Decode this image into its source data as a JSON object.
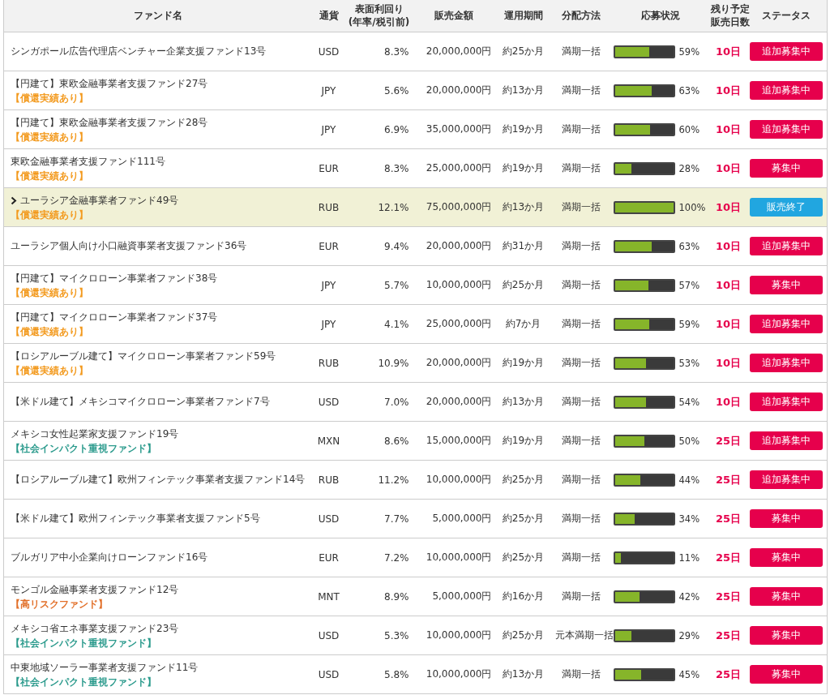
{
  "columns": [
    [
      "ファンド名"
    ],
    [
      "通貨"
    ],
    [
      "表面利回り",
      "(年率/税引前)"
    ],
    [
      "販売金額"
    ],
    [
      "運用期間"
    ],
    [
      "分配方法"
    ],
    [
      "応募状況"
    ],
    [
      "残り予定",
      "販売日数"
    ],
    [
      "ステータス"
    ]
  ],
  "rows": [
    {
      "name": "シンガポール広告代理店ベンチャー企業支援ファンド13号",
      "currency": "USD",
      "rate": "8.3%",
      "amount": "20,000,000円",
      "period": "約25か月",
      "distribution": "満期一括",
      "level": 0.59,
      "percent": "59%",
      "days": "10日",
      "status": {
        "label": "追加募集中",
        "kind": "open"
      },
      "selected": false
    },
    {
      "name": "【円建て】東欧金融事業者支援ファンド27号",
      "tag": {
        "text": "【償還実績あり】",
        "kind": "repaid"
      },
      "currency": "JPY",
      "rate": "5.6%",
      "amount": "20,000,000円",
      "period": "約13か月",
      "distribution": "満期一括",
      "level": 0.63,
      "percent": "63%",
      "days": "10日",
      "status": {
        "label": "追加募集中",
        "kind": "open"
      },
      "selected": false
    },
    {
      "name": "【円建て】東欧金融事業者支援ファンド28号",
      "tag": {
        "text": "【償還実績あり】",
        "kind": "repaid"
      },
      "currency": "JPY",
      "rate": "6.9%",
      "amount": "35,000,000円",
      "period": "約19か月",
      "distribution": "満期一括",
      "level": 0.6,
      "percent": "60%",
      "days": "10日",
      "status": {
        "label": "追加募集中",
        "kind": "open"
      },
      "selected": false
    },
    {
      "name": "東欧金融事業者支援ファンド111号",
      "tag": {
        "text": "【償還実績あり】",
        "kind": "repaid"
      },
      "currency": "EUR",
      "rate": "8.3%",
      "amount": "25,000,000円",
      "period": "約19か月",
      "distribution": "満期一括",
      "level": 0.28,
      "percent": "28%",
      "days": "10日",
      "status": {
        "label": "募集中",
        "kind": "open"
      },
      "selected": false
    },
    {
      "name": "ユーラシア金融事業者ファンド49号",
      "tag": {
        "text": "【償還実績あり】",
        "kind": "repaid"
      },
      "currency": "RUB",
      "rate": "12.1%",
      "amount": "75,000,000円",
      "period": "約13か月",
      "distribution": "満期一括",
      "level": 1,
      "percent": "100%",
      "days": "10日",
      "status": {
        "label": "販売終了",
        "kind": "closed"
      },
      "selected": true
    },
    {
      "name": "ユーラシア個人向け小口融資事業者支援ファンド36号",
      "currency": "EUR",
      "rate": "9.4%",
      "amount": "20,000,000円",
      "period": "約31か月",
      "distribution": "満期一括",
      "level": 0.63,
      "percent": "63%",
      "days": "10日",
      "status": {
        "label": "追加募集中",
        "kind": "open"
      },
      "selected": false
    },
    {
      "name": "【円建て】マイクロローン事業者ファンド38号",
      "tag": {
        "text": "【償還実績あり】",
        "kind": "repaid"
      },
      "currency": "JPY",
      "rate": "5.7%",
      "amount": "10,000,000円",
      "period": "約25か月",
      "distribution": "満期一括",
      "level": 0.57,
      "percent": "57%",
      "days": "10日",
      "status": {
        "label": "募集中",
        "kind": "open"
      },
      "selected": false
    },
    {
      "name": "【円建て】マイクロローン事業者ファンド37号",
      "tag": {
        "text": "【償還実績あり】",
        "kind": "repaid"
      },
      "currency": "JPY",
      "rate": "4.1%",
      "amount": "25,000,000円",
      "period": "約7か月",
      "distribution": "満期一括",
      "level": 0.59,
      "percent": "59%",
      "days": "10日",
      "status": {
        "label": "追加募集中",
        "kind": "open"
      },
      "selected": false
    },
    {
      "name": "【ロシアルーブル建て】マイクロローン事業者ファンド59号",
      "tag": {
        "text": "【償還実績あり】",
        "kind": "repaid"
      },
      "currency": "RUB",
      "rate": "10.9%",
      "amount": "20,000,000円",
      "period": "約19か月",
      "distribution": "満期一括",
      "level": 0.53,
      "percent": "53%",
      "days": "10日",
      "status": {
        "label": "追加募集中",
        "kind": "open"
      },
      "selected": false
    },
    {
      "name": "【米ドル建て】メキシコマイクロローン事業者ファンド7号",
      "currency": "USD",
      "rate": "7.0%",
      "amount": "20,000,000円",
      "period": "約13か月",
      "distribution": "満期一括",
      "level": 0.54,
      "percent": "54%",
      "days": "10日",
      "status": {
        "label": "追加募集中",
        "kind": "open"
      },
      "selected": false
    },
    {
      "name": "メキシコ女性起業家支援ファンド19号",
      "tag": {
        "text": "【社会インパクト重視ファンド】",
        "kind": "impact"
      },
      "currency": "MXN",
      "rate": "8.6%",
      "amount": "15,000,000円",
      "period": "約19か月",
      "distribution": "満期一括",
      "level": 0.5,
      "percent": "50%",
      "days": "25日",
      "status": {
        "label": "追加募集中",
        "kind": "open"
      },
      "selected": false
    },
    {
      "name": "【ロシアルーブル建て】欧州フィンテック事業者支援ファンド14号",
      "currency": "RUB",
      "rate": "11.2%",
      "amount": "10,000,000円",
      "period": "約25か月",
      "distribution": "満期一括",
      "level": 0.44,
      "percent": "44%",
      "days": "25日",
      "status": {
        "label": "追加募集中",
        "kind": "open"
      },
      "selected": false
    },
    {
      "name": "【米ドル建て】欧州フィンテック事業者支援ファンド5号",
      "currency": "USD",
      "rate": "7.7%",
      "amount": "5,000,000円",
      "period": "約25か月",
      "distribution": "満期一括",
      "level": 0.34,
      "percent": "34%",
      "days": "25日",
      "status": {
        "label": "募集中",
        "kind": "open"
      },
      "selected": false
    },
    {
      "name": "ブルガリア中小企業向けローンファンド16号",
      "currency": "EUR",
      "rate": "7.2%",
      "amount": "10,000,000円",
      "period": "約25か月",
      "distribution": "満期一括",
      "level": 0.11,
      "percent": "11%",
      "days": "25日",
      "status": {
        "label": "募集中",
        "kind": "open"
      },
      "selected": false
    },
    {
      "name": "モンゴル金融事業者支援ファンド12号",
      "tag": {
        "text": "【高リスクファンド】",
        "kind": "risk"
      },
      "currency": "MNT",
      "rate": "8.9%",
      "amount": "5,000,000円",
      "period": "約16か月",
      "distribution": "満期一括",
      "level": 0.42,
      "percent": "42%",
      "days": "25日",
      "status": {
        "label": "募集中",
        "kind": "open"
      },
      "selected": false
    },
    {
      "name": "メキシコ省エネ事業支援ファンド23号",
      "tag": {
        "text": "【社会インパクト重視ファンド】",
        "kind": "impact"
      },
      "currency": "USD",
      "rate": "5.3%",
      "amount": "10,000,000円",
      "period": "約25か月",
      "distribution": "元本満期一括",
      "level": 0.29,
      "percent": "29%",
      "days": "25日",
      "status": {
        "label": "募集中",
        "kind": "open"
      },
      "selected": false
    },
    {
      "name": "中東地域ソーラー事業者支援ファンド11号",
      "tag": {
        "text": "【社会インパクト重視ファンド】",
        "kind": "impact"
      },
      "currency": "USD",
      "rate": "5.8%",
      "amount": "10,000,000円",
      "period": "約13か月",
      "distribution": "満期一括",
      "level": 0.45,
      "percent": "45%",
      "days": "25日",
      "status": {
        "label": "募集中",
        "kind": "open"
      },
      "selected": false
    }
  ]
}
